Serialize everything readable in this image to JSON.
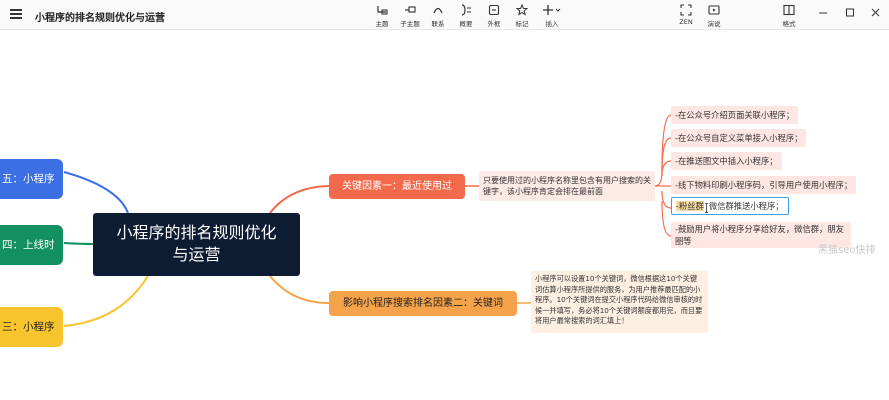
{
  "app": {
    "title": "小程序的排名规则优化与运营"
  },
  "toolbar": {
    "items": [
      {
        "label": "主题",
        "icon": "topic-icon"
      },
      {
        "label": "子主题",
        "icon": "subtopic-icon"
      },
      {
        "label": "联系",
        "icon": "relation-icon"
      },
      {
        "label": "概要",
        "icon": "summary-icon"
      },
      {
        "label": "外框",
        "icon": "boundary-icon"
      },
      {
        "label": "标记",
        "icon": "star-icon"
      },
      {
        "label": "插入",
        "icon": "insert-icon"
      }
    ],
    "right_items": [
      {
        "label": "ZEN",
        "icon": "zen-icon"
      },
      {
        "label": "演说",
        "icon": "present-icon"
      },
      {
        "label": "格式",
        "icon": "format-icon"
      }
    ]
  },
  "mindmap": {
    "root": {
      "line1": "小程序的排名规则优化",
      "line2": "与运营",
      "color": "#0d1b33"
    },
    "left_nodes": [
      {
        "label": "五：小程序",
        "color": "#3b6fe3"
      },
      {
        "label": "四：上线时",
        "color": "#13905f"
      },
      {
        "label": "三：小程序",
        "color": "#f7c42d"
      }
    ],
    "main_topics": [
      {
        "label": "关键因素一：最近使用过",
        "color": "#f26a4b"
      },
      {
        "label": "影响小程序搜索排名因素二：关键词",
        "color": "#f5a34a"
      }
    ],
    "note1": "只要使用过的小程序名称里包含有用户搜索的关键字，该小程序肯定会排在最前面",
    "note2": "小程序可以设置10个关键词，微信根据这10个关键词估算小程序所提供的服务，为用户推荐最匹配的小程序。10个关键词在提交小程序代码给微信审核的时候一并填写，务必将10个关键词额度都用完，而且要将用户最常搜索的词汇填上！",
    "leaves": [
      "-在公众号介绍页面关联小程序；",
      "-在公众号自定义菜单接入小程序；",
      "-在推送图文中插入小程序；",
      "-线下物料印刷小程序码，引导用户使用小程序；",
      {
        "highlight": "-粉丝群",
        "rest": "微信群推送小程序；"
      },
      "-鼓励用户将小程序分享给好友，微信群，朋友圈等"
    ],
    "watermark": "黑猫seo快排"
  },
  "colors": {
    "link_blue": "#3b6fe3",
    "link_green": "#13905f",
    "link_yellow": "#f7c42d",
    "link_red": "#f26a4b",
    "link_orange": "#f5a34a",
    "selection": "#3aa0e8"
  }
}
